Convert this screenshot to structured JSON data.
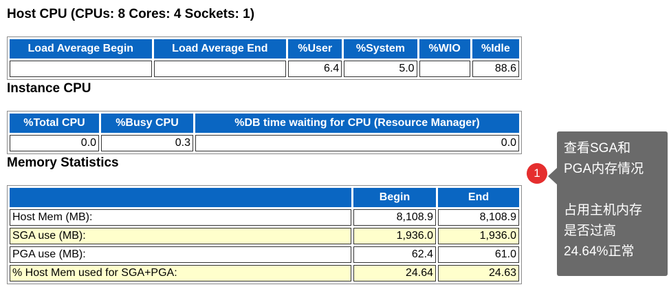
{
  "host_cpu": {
    "title": "Host CPU (CPUs: 8 Cores: 4 Sockets: 1)",
    "headers": [
      "Load Average Begin",
      "Load Average End",
      "%User",
      "%System",
      "%WIO",
      "%Idle"
    ],
    "row": [
      "",
      "",
      "6.4",
      "5.0",
      "",
      "88.6"
    ]
  },
  "instance_cpu": {
    "title": "Instance CPU",
    "headers": [
      "%Total CPU",
      "%Busy CPU",
      "%DB time waiting for CPU (Resource Manager)"
    ],
    "row": [
      "0.0",
      "0.3",
      "0.0"
    ]
  },
  "memory_stats": {
    "title": "Memory Statistics",
    "headers": [
      "",
      "Begin",
      "End"
    ],
    "rows": [
      {
        "label": "Host Mem (MB):",
        "begin": "8,108.9",
        "end": "8,108.9"
      },
      {
        "label": "SGA use (MB):",
        "begin": "1,936.0",
        "end": "1,936.0"
      },
      {
        "label": "PGA use (MB):",
        "begin": "62.4",
        "end": "61.0"
      },
      {
        "label": "% Host Mem used for SGA+PGA:",
        "begin": "24.64",
        "end": "24.63"
      }
    ]
  },
  "annotation": {
    "badge": "1",
    "line1": "查看SGA和",
    "line2": "PGA内存情况",
    "line3": "占用主机内存",
    "line4": "是否过高",
    "line5": "24.64%正常"
  },
  "colors": {
    "header_bg": "#0a66c2",
    "alt_row_bg": "#ffffcc",
    "callout_bg": "#6a6a6a",
    "badge_bg": "#e52e2e"
  }
}
